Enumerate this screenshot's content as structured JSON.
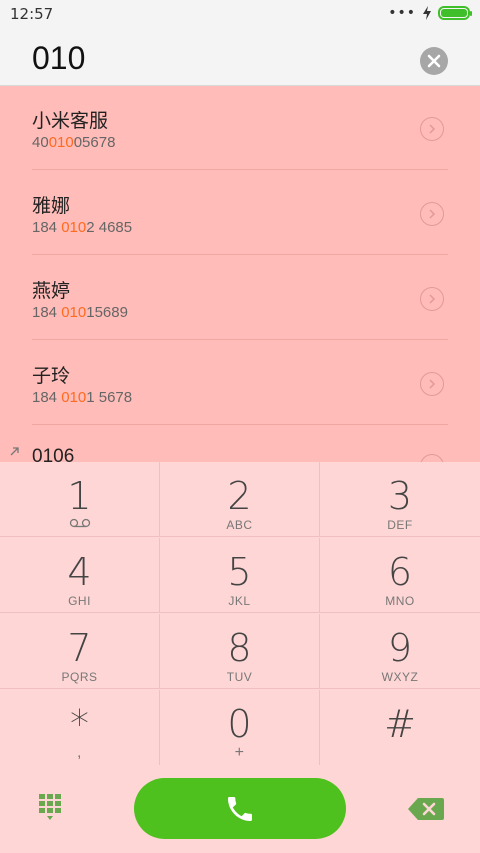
{
  "status_bar": {
    "time": "12:57",
    "dots": "•••"
  },
  "input": {
    "number": "010"
  },
  "results": [
    {
      "name": "小米客服",
      "num_pre": "40",
      "num_hl": "010",
      "num_post": "05678"
    },
    {
      "name": "雅娜",
      "num_pre": "184 ",
      "num_hl": "010",
      "num_post": "2 4685"
    },
    {
      "name": "燕婷",
      "num_pre": "184 ",
      "num_hl": "010",
      "num_post": "15689"
    },
    {
      "name": "子玲",
      "num_pre": "184 ",
      "num_hl": "010",
      "num_post": "1 5678"
    },
    {
      "name": "0106",
      "num_pre": "",
      "num_hl": "",
      "num_post": ""
    }
  ],
  "keys": [
    {
      "digit": "1",
      "letters": ""
    },
    {
      "digit": "2",
      "letters": "ABC"
    },
    {
      "digit": "3",
      "letters": "DEF"
    },
    {
      "digit": "4",
      "letters": "GHI"
    },
    {
      "digit": "5",
      "letters": "JKL"
    },
    {
      "digit": "6",
      "letters": "MNO"
    },
    {
      "digit": "7",
      "letters": "PQRS"
    },
    {
      "digit": "8",
      "letters": "TUV"
    },
    {
      "digit": "9",
      "letters": "WXYZ"
    },
    {
      "digit": "*",
      "letters": ","
    },
    {
      "digit": "0",
      "letters": "+"
    },
    {
      "digit": "#",
      "letters": ""
    }
  ],
  "icons": {
    "voicemail": "voicemail-icon",
    "call": "phone-icon",
    "dialpad": "dialpad-icon",
    "backspace": "backspace-icon",
    "clear": "clear-icon",
    "arrow": "chevron-right-icon",
    "recent": "outgoing-call-icon"
  },
  "colors": {
    "highlight": "#ff6a1f",
    "results_bg": "#ffbcb8",
    "keypad_bg": "#ffd6d6",
    "call_green": "#4ec11e"
  }
}
